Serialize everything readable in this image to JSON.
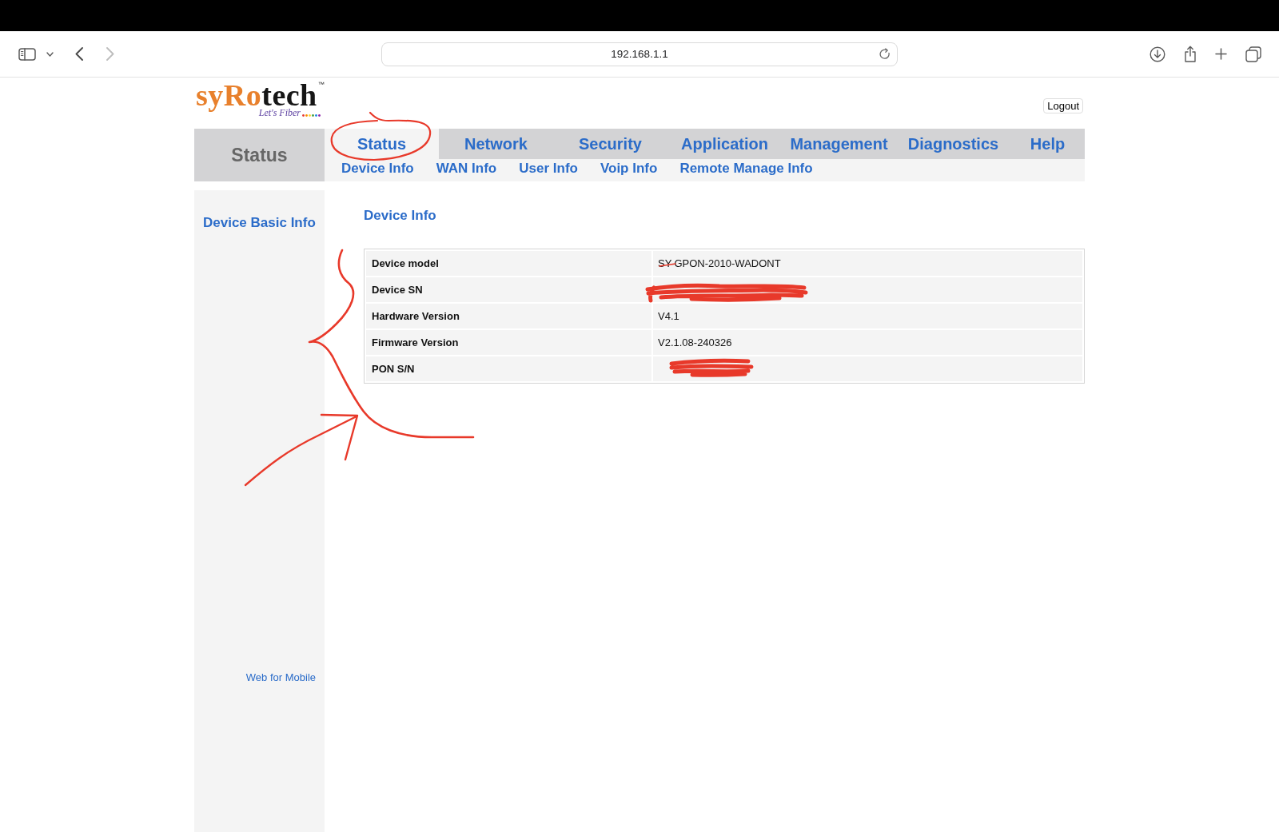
{
  "browser": {
    "url": "192.168.1.1",
    "back_disabled": false,
    "forward_disabled": true
  },
  "logo": {
    "accent": "syRo",
    "rest": "tech",
    "trademark": "™",
    "tagline": "Let's Fiber"
  },
  "logout": {
    "label": "Logout"
  },
  "section_title": "Status",
  "tabs": [
    {
      "label": "Status",
      "selected": true
    },
    {
      "label": "Network",
      "selected": false
    },
    {
      "label": "Security",
      "selected": false
    },
    {
      "label": "Application",
      "selected": false
    },
    {
      "label": "Management",
      "selected": false
    },
    {
      "label": "Diagnostics",
      "selected": false
    },
    {
      "label": "Help",
      "selected": false
    }
  ],
  "subtabs": [
    {
      "label": "Device Info"
    },
    {
      "label": "WAN Info"
    },
    {
      "label": "User Info"
    },
    {
      "label": "Voip Info"
    },
    {
      "label": "Remote Manage Info"
    }
  ],
  "sidebar": {
    "items": [
      {
        "label": "Device Basic Info"
      }
    ],
    "footer_link": "Web for Mobile"
  },
  "panel": {
    "title": "Device Info",
    "rows": [
      {
        "label": "Device model",
        "value": "SY-GPON-2010-WADONT",
        "redacted": false
      },
      {
        "label": "Device SN",
        "redacted": true
      },
      {
        "label": "Hardware Version",
        "value": "V4.1",
        "redacted": false
      },
      {
        "label": "Firmware Version",
        "value": "V2.1.08-240326",
        "redacted": false
      },
      {
        "label": "PON S/N",
        "redacted": true
      }
    ]
  },
  "annotations": [
    {
      "kind": "circle"
    },
    {
      "kind": "strike"
    },
    {
      "kind": "brace"
    },
    {
      "kind": "arrow"
    }
  ]
}
